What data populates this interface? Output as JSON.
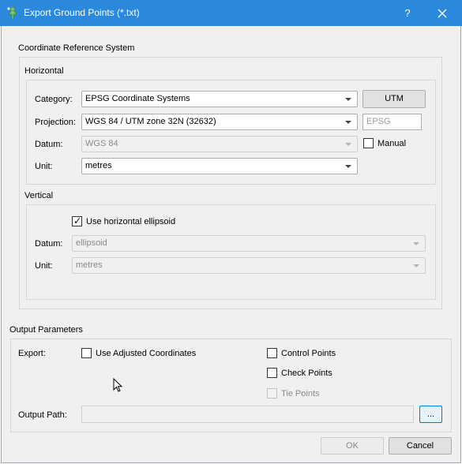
{
  "window": {
    "title": "Export Ground Points (*.txt)",
    "help_label": "?",
    "accent": "#2a88dd"
  },
  "crs": {
    "section_title": "Coordinate Reference System",
    "horizontal": {
      "title": "Horizontal",
      "category_label": "Category:",
      "category_value": "EPSG Coordinate Systems",
      "utm_button": "UTM",
      "projection_label": "Projection:",
      "projection_value": "WGS 84 / UTM zone 32N (32632)",
      "epsg_placeholder": "EPSG",
      "datum_label": "Datum:",
      "datum_value": "WGS 84",
      "manual_label": "Manual",
      "manual_checked": false,
      "unit_label": "Unit:",
      "unit_value": "metres"
    },
    "vertical": {
      "title": "Vertical",
      "use_ellipsoid_label": "Use horizontal ellipsoid",
      "use_ellipsoid_checked": true,
      "datum_label": "Datum:",
      "datum_value": "ellipsoid",
      "unit_label": "Unit:",
      "unit_value": "metres"
    }
  },
  "output": {
    "section_title": "Output Parameters",
    "export_label": "Export:",
    "use_adjusted_label": "Use Adjusted Coordinates",
    "control_points_label": "Control Points",
    "check_points_label": "Check Points",
    "tie_points_label": "Tie Points",
    "output_path_label": "Output Path:",
    "output_path_value": "",
    "browse_label": "..."
  },
  "buttons": {
    "ok": "OK",
    "cancel": "Cancel"
  }
}
